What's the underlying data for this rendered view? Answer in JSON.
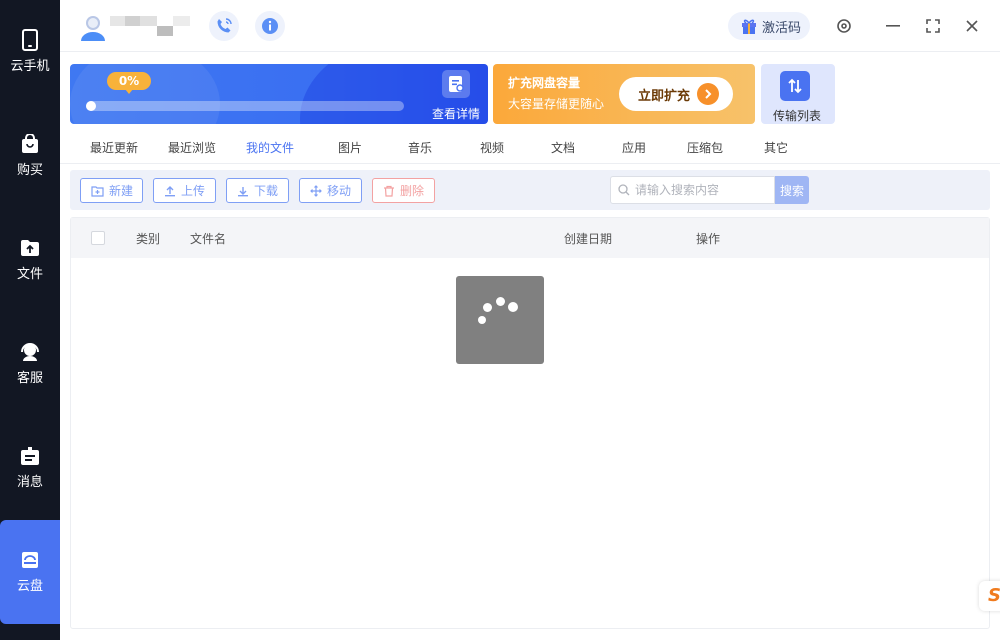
{
  "sidebar": {
    "items": [
      {
        "label": "云手机",
        "icon": "phone-icon"
      },
      {
        "label": "购买",
        "icon": "shopping-bag-icon"
      },
      {
        "label": "文件",
        "icon": "folder-upload-icon"
      },
      {
        "label": "客服",
        "icon": "headset-icon"
      },
      {
        "label": "消息",
        "icon": "message-icon"
      },
      {
        "label": "云盘",
        "icon": "cloud-disk-icon"
      }
    ],
    "active": "云盘"
  },
  "header": {
    "activate_label": "激活码"
  },
  "banner": {
    "progress_percent": "0%",
    "progress_value": 0,
    "detail_label": "查看详情",
    "expand_title": "扩充网盘容量",
    "expand_subtitle": "大容量存储更随心",
    "expand_button": "立即扩充",
    "transfer_label": "传输列表"
  },
  "tabs": [
    {
      "label": "最近更新"
    },
    {
      "label": "最近浏览"
    },
    {
      "label": "我的文件"
    },
    {
      "label": "图片"
    },
    {
      "label": "音乐"
    },
    {
      "label": "视频"
    },
    {
      "label": "文档"
    },
    {
      "label": "应用"
    },
    {
      "label": "压缩包"
    },
    {
      "label": "其它"
    }
  ],
  "active_tab": "我的文件",
  "toolbar": {
    "new_label": "新建",
    "upload_label": "上传",
    "download_label": "下载",
    "move_label": "移动",
    "delete_label": "删除",
    "search_placeholder": "请输入搜索内容",
    "search_button": "搜索"
  },
  "table": {
    "columns": [
      "类别",
      "文件名",
      "创建日期",
      "操作"
    ]
  },
  "colors": {
    "accent": "#4a73f1",
    "sidebar_bg": "#121723",
    "banner_blue": "#3a6ff2",
    "banner_orange": "#fba83a",
    "danger": "#f3a2a2"
  }
}
